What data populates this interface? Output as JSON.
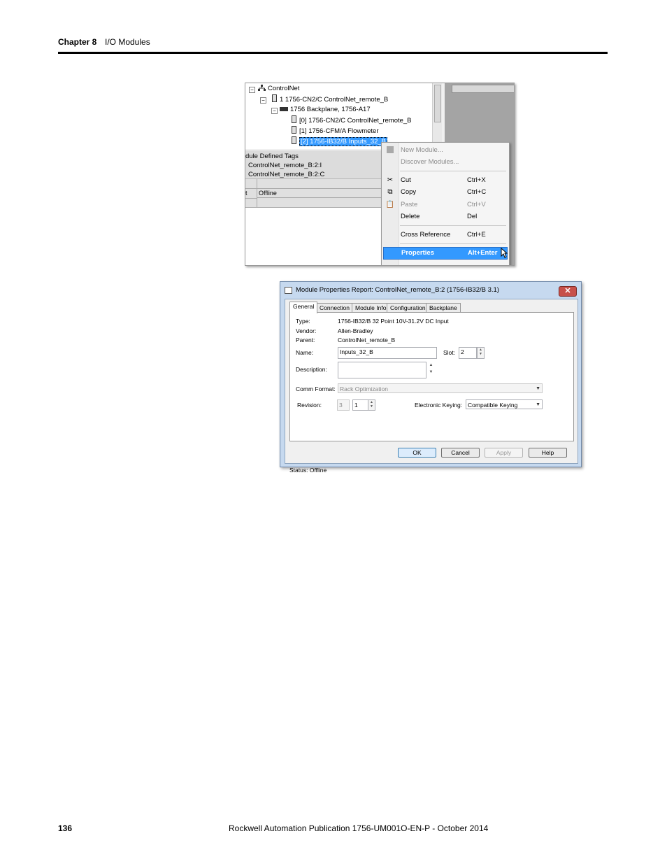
{
  "header": {
    "chapter": "Chapter 8",
    "title": "I/O Modules"
  },
  "footer": {
    "page_number": "136",
    "publication": "Rockwell Automation Publication 1756-UM001O-EN-P - October 2014"
  },
  "tree": {
    "items": [
      {
        "label": "ControlNet"
      },
      {
        "label": "1 1756-CN2/C ControlNet_remote_B"
      },
      {
        "label": "1756 Backplane, 1756-A17"
      },
      {
        "label": "[0] 1756-CN2/C ControlNet_remote_B"
      },
      {
        "label": "[1] 1756-CFM/A Flowmeter"
      },
      {
        "label": "[2] 1756-IB32/B Inputs_32_B"
      }
    ]
  },
  "tags_panel": {
    "title": "dule Defined Tags",
    "rows": [
      "ControlNet_remote_B:2:I",
      "ControlNet_remote_B:2:C"
    ],
    "status_cell": "Offline",
    "left_cell": "t"
  },
  "context_menu": {
    "items": [
      {
        "label": "New Module...",
        "shortcut": ""
      },
      {
        "label": "Discover Modules...",
        "shortcut": ""
      },
      {
        "label": "Cut",
        "shortcut": "Ctrl+X"
      },
      {
        "label": "Copy",
        "shortcut": "Ctrl+C"
      },
      {
        "label": "Paste",
        "shortcut": "Ctrl+V"
      },
      {
        "label": "Delete",
        "shortcut": "Del"
      },
      {
        "label": "Cross Reference",
        "shortcut": "Ctrl+E"
      },
      {
        "label": "Properties",
        "shortcut": "Alt+Enter"
      }
    ],
    "icons": [
      "new-module-icon",
      "cut-icon",
      "copy-icon",
      "paste-icon"
    ]
  },
  "dialog": {
    "title": "Module Properties Report: ControlNet_remote_B:2 (1756-IB32/B 3.1)",
    "close_glyph": "✕",
    "tabs": [
      "General",
      "Connection",
      "Module Info",
      "Configuration",
      "Backplane"
    ],
    "type_label": "Type:",
    "type_value": "1756-IB32/B 32 Point 10V-31.2V DC Input",
    "vendor_label": "Vendor:",
    "vendor_value": "Allen-Bradley",
    "parent_label": "Parent:",
    "parent_value": "ControlNet_remote_B",
    "name_label": "Name:",
    "name_value": "Inputs_32_B",
    "slot_label": "Slot:",
    "slot_value": "2",
    "description_label": "Description:",
    "description_value": "",
    "comm_format_label": "Comm Format:",
    "comm_format_value": "Rack Optimization",
    "revision_label": "Revision:",
    "revision_major": "3",
    "revision_minor": "1",
    "keying_label": "Electronic Keying:",
    "keying_value": "Compatible Keying",
    "status_label": "Status:",
    "status_value": "Offline",
    "buttons": {
      "ok": "OK",
      "cancel": "Cancel",
      "apply": "Apply",
      "help": "Help"
    }
  },
  "colors": {
    "selection": "#3399ff",
    "dialog_frame": "#c6d9ef",
    "close_button": "#c7504a"
  }
}
